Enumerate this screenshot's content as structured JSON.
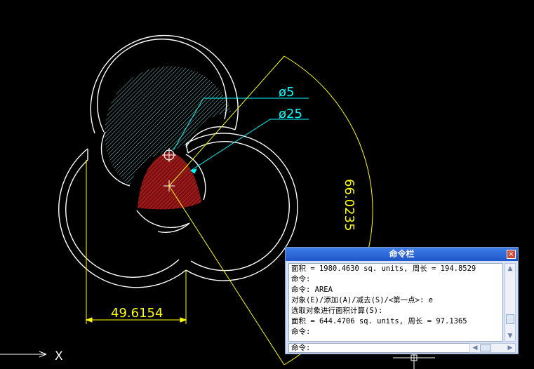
{
  "drawing": {
    "dim_diameter_small": "ø5",
    "dim_diameter_large": "ø25",
    "dim_arc": "66.0235",
    "dim_linear": "49.6154",
    "axis_x_label": "X"
  },
  "command_window": {
    "title": "命令栏",
    "close_symbol": "×",
    "history": [
      "面积 = 1980.4630 sq. units, 周长 = 194.8529",
      "命令:",
      "命令: AREA",
      "对象(E)/添加(A)/减去(S)/<第一点>: e",
      "选取对象进行面积计算(S):",
      "面积 = 644.4706 sq. units, 周长 = 97.1365",
      "命令:"
    ],
    "prompt": "命令:"
  },
  "colors": {
    "background": "#000000",
    "geometry": "#ffffff",
    "dimension": "#ffff00",
    "leader": "#00ffff",
    "hatch_cyan": "#7fe0e0",
    "hatch_red": "#c02020",
    "title_bar": "#2a66d8"
  }
}
